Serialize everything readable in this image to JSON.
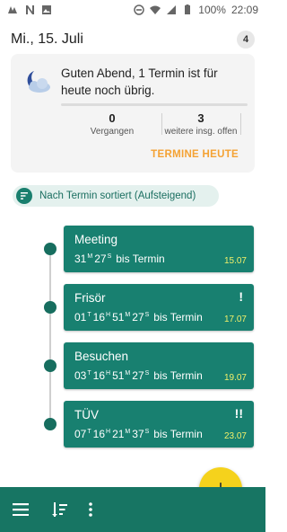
{
  "status_bar": {
    "battery": "100%",
    "time": "22:09"
  },
  "header": {
    "date": "Mi., 15. Juli",
    "count": "4"
  },
  "summary": {
    "greeting": "Guten Abend, 1 Termin ist für heute noch übrig.",
    "past_count": "0",
    "past_label": "Vergangen",
    "open_count": "3",
    "open_label": "weitere insg. offen",
    "action_label": "TERMINE HEUTE"
  },
  "sort": {
    "label": "Nach Termin sortiert (Aufsteigend)"
  },
  "events": [
    {
      "title": "Meeting",
      "flag": "",
      "countdown": [
        [
          "31",
          "M"
        ],
        [
          "27",
          "S"
        ]
      ],
      "suffix": "bis Termin",
      "date": "15.07"
    },
    {
      "title": "Frisör",
      "flag": "!",
      "countdown": [
        [
          "01",
          "T"
        ],
        [
          "16",
          "H"
        ],
        [
          "51",
          "M"
        ],
        [
          "27",
          "S"
        ]
      ],
      "suffix": "bis Termin",
      "date": "17.07"
    },
    {
      "title": "Besuchen",
      "flag": "",
      "countdown": [
        [
          "03",
          "T"
        ],
        [
          "16",
          "H"
        ],
        [
          "51",
          "M"
        ],
        [
          "27",
          "S"
        ]
      ],
      "suffix": "bis Termin",
      "date": "19.07"
    },
    {
      "title": "TÜV",
      "flag": "!!",
      "countdown": [
        [
          "07",
          "T"
        ],
        [
          "16",
          "H"
        ],
        [
          "21",
          "M"
        ],
        [
          "37",
          "S"
        ]
      ],
      "suffix": "bis Termin",
      "date": "23.07"
    }
  ],
  "fab": {
    "label": "+"
  },
  "icons": {
    "menu": "menu-icon",
    "sort": "sort-icon",
    "more": "more-vert-icon",
    "weather": "moon-cloud-icon"
  },
  "colors": {
    "primary": "#188070",
    "accent": "#f5d21c",
    "action": "#f4a234",
    "date_text": "#f1f06a"
  }
}
